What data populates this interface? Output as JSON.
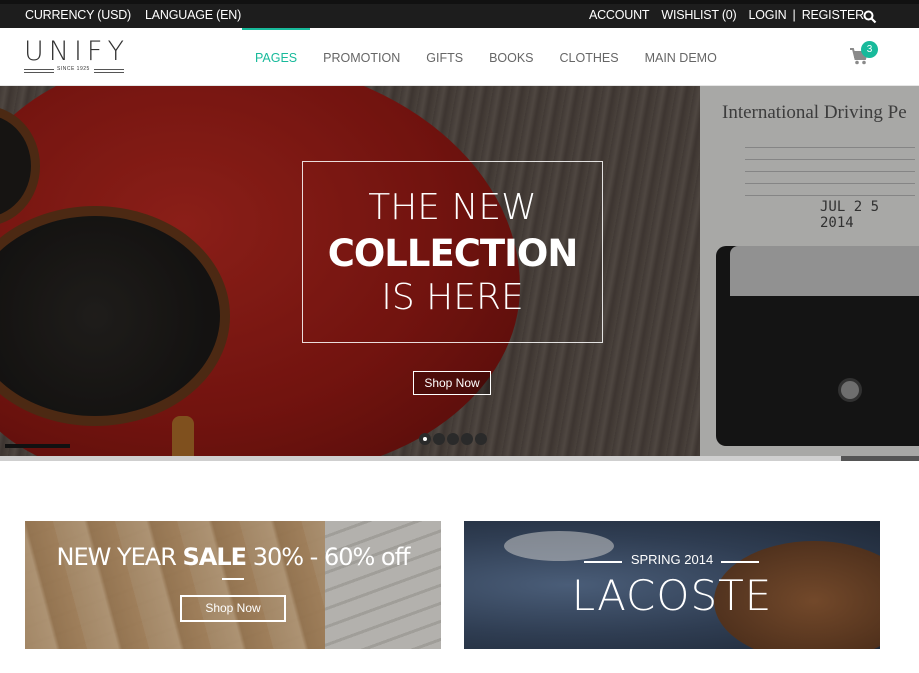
{
  "topbar": {
    "currency": "CURRENCY (USD)",
    "language": "LANGUAGE (EN)",
    "account": "ACCOUNT",
    "wishlist": "WISHLIST (0)",
    "login": "LOGIN",
    "separator": "|",
    "register": "REGISTER",
    "search_icon": "search-icon"
  },
  "header": {
    "logo_text": "UNIFY",
    "logo_since": "SINCE 1925",
    "nav": [
      "PAGES",
      "PROMOTION",
      "GIFTS",
      "BOOKS",
      "CLOTHES",
      "MAIN DEMO"
    ],
    "active_nav": "PAGES",
    "cart_icon": "shopping-cart-icon",
    "cart_count": "3"
  },
  "hero": {
    "line1": "THE NEW",
    "line2": "COLLECTION",
    "line3": "IS HERE",
    "button": "Shop Now",
    "slide_count": 5,
    "active_slide": 1,
    "bg_text_title": "International Driving Pe",
    "bg_text_date": "JUL 2 5 2014"
  },
  "banners": {
    "left": {
      "title_prefix": "NEW YEAR ",
      "title_bold": "SALE",
      "title_suffix": " 30% - 60% off",
      "button": "Shop Now"
    },
    "right": {
      "subtitle": "SPRING 2014",
      "title": "LACOSTE"
    }
  },
  "colors": {
    "accent": "#18ba9b",
    "topbar_bg": "#1d1d1d"
  }
}
